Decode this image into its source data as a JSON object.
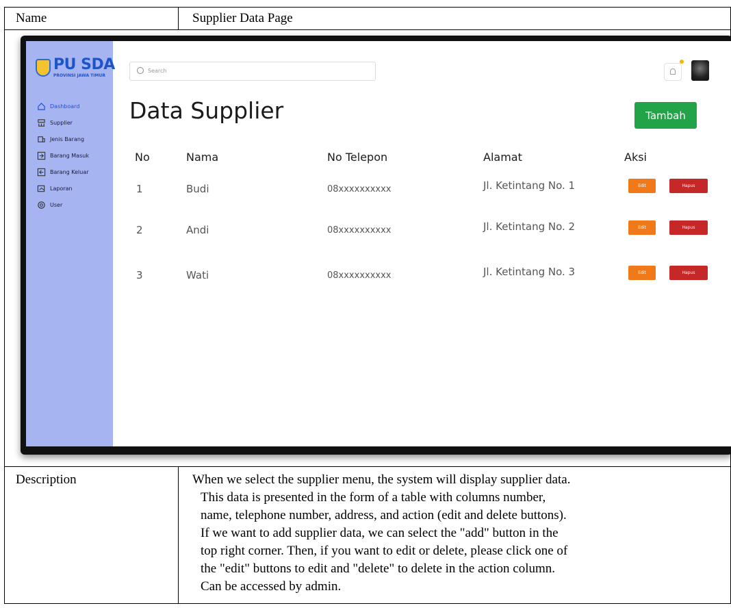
{
  "document": {
    "name_label": "Name",
    "name_value": "Supplier Data Page",
    "description_label": "Description",
    "description_lines": [
      "When we select the supplier menu, the system will display supplier data.",
      "This data is presented in the form of a table with columns number,",
      "name, telephone number, address, and action (edit and delete buttons).",
      "If we want to add supplier data, we can select the \"add\" button in the",
      "top right corner. Then, if you want to edit or delete, please click one of",
      "the \"edit\" buttons to edit and \"delete\" to delete in the action column.",
      "Can be accessed by admin."
    ]
  },
  "app": {
    "logo_text": "PU SDA",
    "logo_subtext": "PROVINSI JAWA TIMUR",
    "sidebar": {
      "items": [
        {
          "label": "Dashboard",
          "icon": "home-icon"
        },
        {
          "label": "Supplier",
          "icon": "supplier-icon"
        },
        {
          "label": "Jenis Barang",
          "icon": "box-icon"
        },
        {
          "label": "Barang Masuk",
          "icon": "incoming-icon"
        },
        {
          "label": "Barang Keluar",
          "icon": "outgoing-icon"
        },
        {
          "label": "Laporan",
          "icon": "report-icon"
        },
        {
          "label": "User",
          "icon": "user-gear-icon"
        }
      ],
      "active_color": "#2450d6",
      "background": "#a6b4f2"
    },
    "search": {
      "placeholder": "Search"
    },
    "page_title": "Data Supplier",
    "add_button_label": "Tambah",
    "table": {
      "headers": [
        "No",
        "Nama",
        "No Telepon",
        "Alamat",
        "Aksi"
      ],
      "rows": [
        {
          "no": "1",
          "nama": "Budi",
          "telepon": "08xxxxxxxxxx",
          "alamat": "Jl. Ketintang No. 1"
        },
        {
          "no": "2",
          "nama": "Andi",
          "telepon": "08xxxxxxxxxx",
          "alamat": "Jl. Ketintang No. 2"
        },
        {
          "no": "3",
          "nama": "Wati",
          "telepon": "08xxxxxxxxxx",
          "alamat": "Jl. Ketintang No. 3"
        }
      ],
      "edit_label": "Edit",
      "delete_label": "Hapus"
    },
    "colors": {
      "add": "#22a347",
      "edit": "#f07a1a",
      "delete": "#c62828"
    }
  }
}
